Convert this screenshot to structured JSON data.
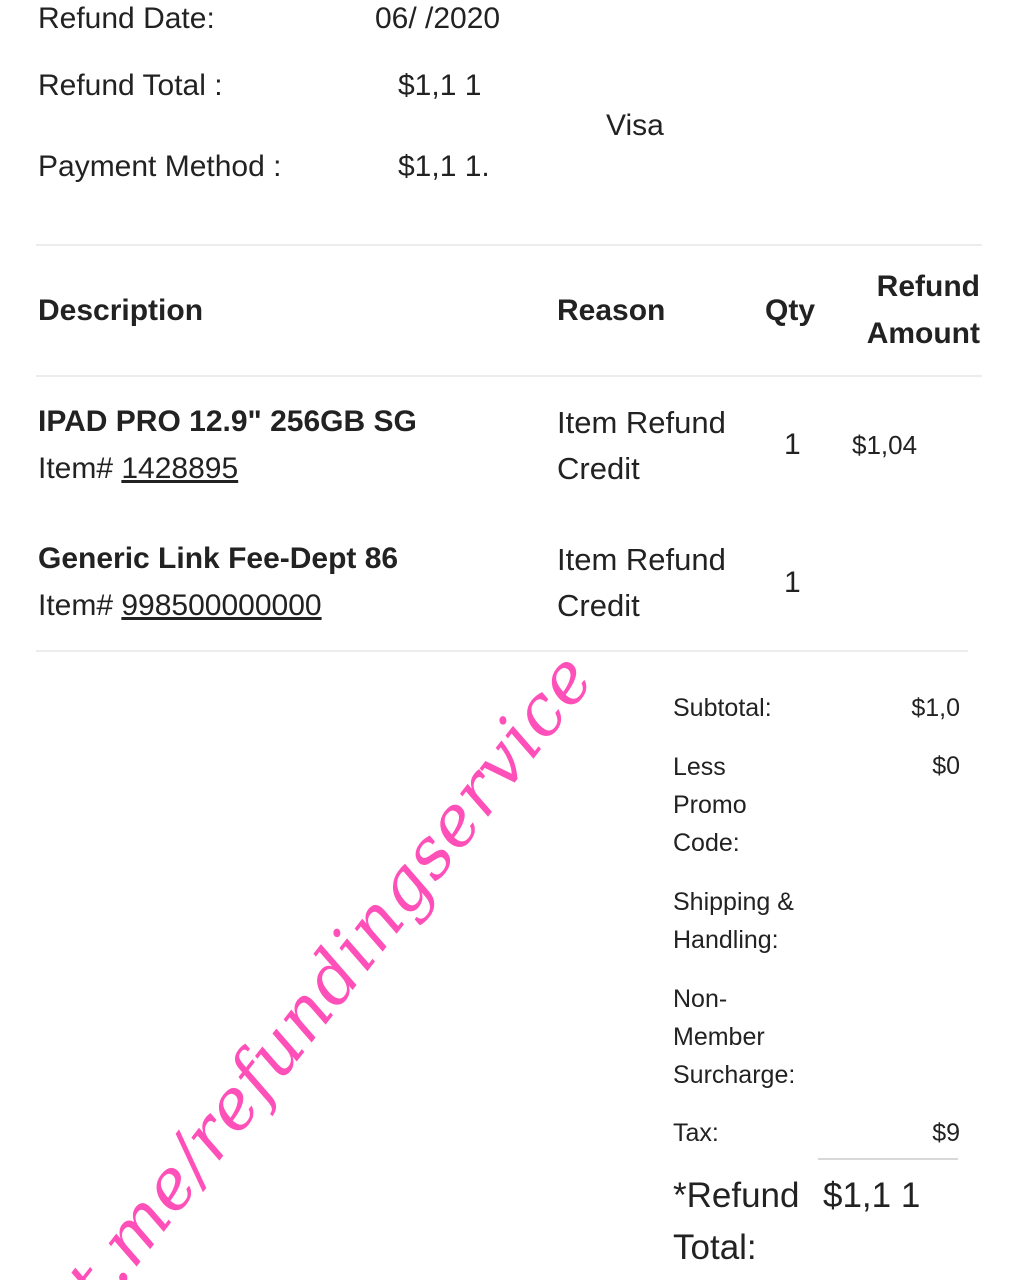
{
  "summary": {
    "refund_date_label": "Refund Date:",
    "refund_date_value": "06/ /2020",
    "refund_total_label": "Refund Total :",
    "refund_total_value": "$1,1 1",
    "payment_method_label": "Payment Method :",
    "payment_method_type": "Visa",
    "payment_method_value": "$1,1 1."
  },
  "table": {
    "headers": {
      "description": "Description",
      "reason": "Reason",
      "qty": "Qty",
      "refund_amount_line1": "Refund",
      "refund_amount_line2": "Amount"
    },
    "rows": [
      {
        "title": "IPAD PRO 12.9\" 256GB SG",
        "item_prefix": "Item#",
        "item_number": "1428895",
        "reason_line1": "Item Refund",
        "reason_line2": "Credit",
        "qty": "1",
        "amount": "$1,04"
      },
      {
        "title": "Generic Link Fee-Dept 86",
        "item_prefix": "Item#",
        "item_number": "998500000000",
        "reason_line1": "Item Refund",
        "reason_line2": "Credit",
        "qty": "1",
        "amount": ""
      }
    ]
  },
  "totals": {
    "subtotal_label": "Subtotal:",
    "subtotal_value": "$1,0",
    "promo_label_1": "Less",
    "promo_label_2": "Promo",
    "promo_label_3": "Code:",
    "promo_value": "$0",
    "shipping_label_1": "Shipping &",
    "shipping_label_2": "Handling:",
    "shipping_value": "",
    "surcharge_label_1": "Non-",
    "surcharge_label_2": "Member",
    "surcharge_label_3": "Surcharge:",
    "surcharge_value": "",
    "tax_label": "Tax:",
    "tax_value": "$9",
    "refund_total_label_1": "*Refund",
    "refund_total_label_2": "Total:",
    "refund_total_value": "$1,1 1"
  },
  "watermark": {
    "text": "t.me/refundingservice"
  }
}
